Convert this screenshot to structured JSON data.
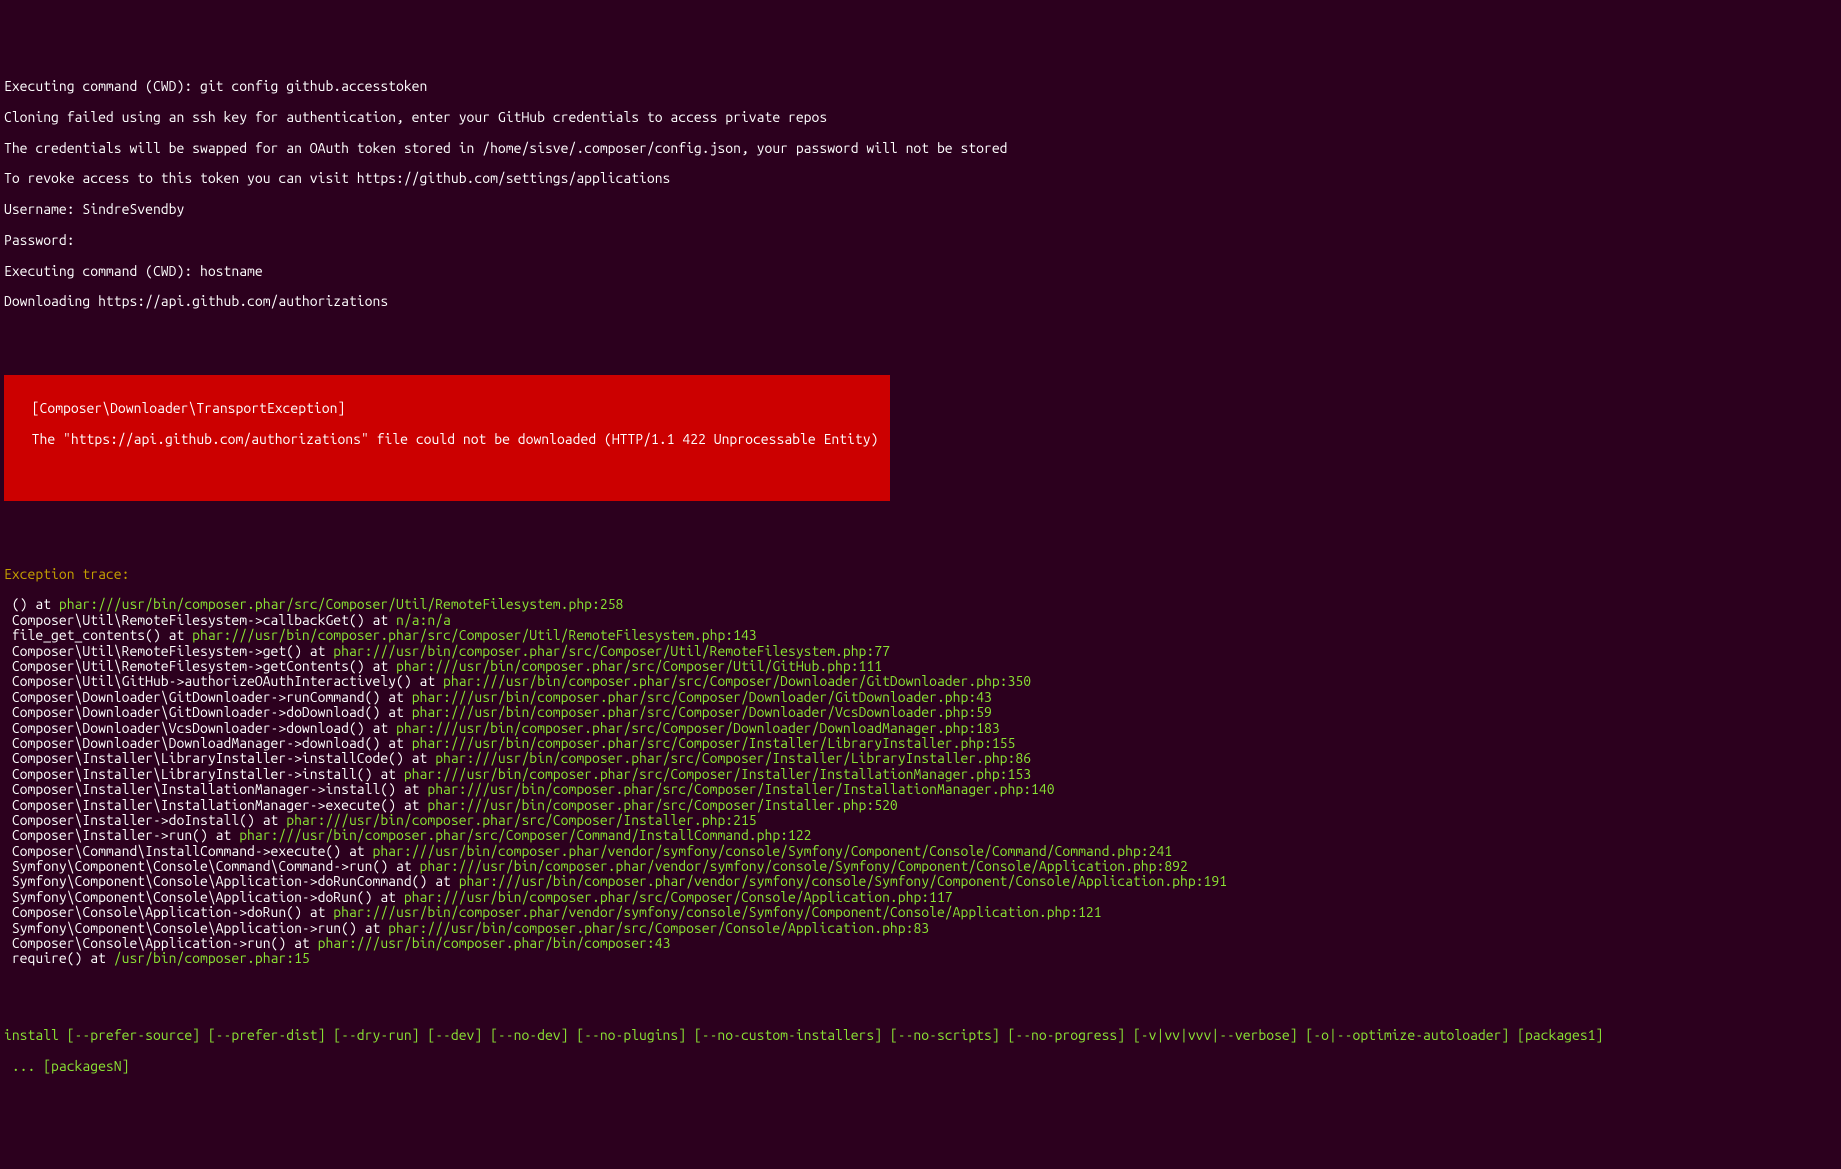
{
  "preamble": [
    "Executing command (CWD): git config github.accesstoken",
    "Cloning failed using an ssh key for authentication, enter your GitHub credentials to access private repos",
    "The credentials will be swapped for an OAuth token stored in /home/sisve/.composer/config.json, your password will not be stored",
    "To revoke access to this token you can visit https://github.com/settings/applications",
    "Username: SindreSvendby",
    "Password:",
    "Executing command (CWD): hostname",
    "Downloading https://api.github.com/authorizations"
  ],
  "error_box": {
    "line1": "  [Composer\\Downloader\\TransportException]",
    "line2": "  The \"https://api.github.com/authorizations\" file could not be downloaded (HTTP/1.1 422 Unprocessable Entity)"
  },
  "trace_header": "Exception trace:",
  "trace": [
    {
      "pre": " () at ",
      "path": "phar:///usr/bin/composer.phar/src/Composer/Util/RemoteFilesystem.php:258"
    },
    {
      "pre": " Composer\\Util\\RemoteFilesystem->callbackGet() at ",
      "path": "n/a:n/a"
    },
    {
      "pre": " file_get_contents() at ",
      "path": "phar:///usr/bin/composer.phar/src/Composer/Util/RemoteFilesystem.php:143"
    },
    {
      "pre": " Composer\\Util\\RemoteFilesystem->get() at ",
      "path": "phar:///usr/bin/composer.phar/src/Composer/Util/RemoteFilesystem.php:77"
    },
    {
      "pre": " Composer\\Util\\RemoteFilesystem->getContents() at ",
      "path": "phar:///usr/bin/composer.phar/src/Composer/Util/GitHub.php:111"
    },
    {
      "pre": " Composer\\Util\\GitHub->authorizeOAuthInteractively() at ",
      "path": "phar:///usr/bin/composer.phar/src/Composer/Downloader/GitDownloader.php:350"
    },
    {
      "pre": " Composer\\Downloader\\GitDownloader->runCommand() at ",
      "path": "phar:///usr/bin/composer.phar/src/Composer/Downloader/GitDownloader.php:43"
    },
    {
      "pre": " Composer\\Downloader\\GitDownloader->doDownload() at ",
      "path": "phar:///usr/bin/composer.phar/src/Composer/Downloader/VcsDownloader.php:59"
    },
    {
      "pre": " Composer\\Downloader\\VcsDownloader->download() at ",
      "path": "phar:///usr/bin/composer.phar/src/Composer/Downloader/DownloadManager.php:183"
    },
    {
      "pre": " Composer\\Downloader\\DownloadManager->download() at ",
      "path": "phar:///usr/bin/composer.phar/src/Composer/Installer/LibraryInstaller.php:155"
    },
    {
      "pre": " Composer\\Installer\\LibraryInstaller->installCode() at ",
      "path": "phar:///usr/bin/composer.phar/src/Composer/Installer/LibraryInstaller.php:86"
    },
    {
      "pre": " Composer\\Installer\\LibraryInstaller->install() at ",
      "path": "phar:///usr/bin/composer.phar/src/Composer/Installer/InstallationManager.php:153"
    },
    {
      "pre": " Composer\\Installer\\InstallationManager->install() at ",
      "path": "phar:///usr/bin/composer.phar/src/Composer/Installer/InstallationManager.php:140"
    },
    {
      "pre": " Composer\\Installer\\InstallationManager->execute() at ",
      "path": "phar:///usr/bin/composer.phar/src/Composer/Installer.php:520"
    },
    {
      "pre": " Composer\\Installer->doInstall() at ",
      "path": "phar:///usr/bin/composer.phar/src/Composer/Installer.php:215"
    },
    {
      "pre": " Composer\\Installer->run() at ",
      "path": "phar:///usr/bin/composer.phar/src/Composer/Command/InstallCommand.php:122"
    },
    {
      "pre": " Composer\\Command\\InstallCommand->execute() at ",
      "path": "phar:///usr/bin/composer.phar/vendor/symfony/console/Symfony/Component/Console/Command/Command.php:241"
    },
    {
      "pre": " Symfony\\Component\\Console\\Command\\Command->run() at ",
      "path": "phar:///usr/bin/composer.phar/vendor/symfony/console/Symfony/Component/Console/Application.php:892"
    },
    {
      "pre": " Symfony\\Component\\Console\\Application->doRunCommand() at ",
      "path": "phar:///usr/bin/composer.phar/vendor/symfony/console/Symfony/Component/Console/Application.php:191"
    },
    {
      "pre": " Symfony\\Component\\Console\\Application->doRun() at ",
      "path": "phar:///usr/bin/composer.phar/src/Composer/Console/Application.php:117"
    },
    {
      "pre": " Composer\\Console\\Application->doRun() at ",
      "path": "phar:///usr/bin/composer.phar/vendor/symfony/console/Symfony/Component/Console/Application.php:121"
    },
    {
      "pre": " Symfony\\Component\\Console\\Application->run() at ",
      "path": "phar:///usr/bin/composer.phar/src/Composer/Console/Application.php:83"
    },
    {
      "pre": " Composer\\Console\\Application->run() at ",
      "path": "phar:///usr/bin/composer.phar/bin/composer:43"
    },
    {
      "pre": " require() at ",
      "path": "/usr/bin/composer.phar:15"
    }
  ],
  "usage": {
    "line1": "install [--prefer-source] [--prefer-dist] [--dry-run] [--dev] [--no-dev] [--no-plugins] [--no-custom-installers] [--no-scripts] [--no-progress] [-v|vv|vvv|--verbose] [-o|--optimize-autoloader] [packages1]",
    "line2": " ... [packagesN]"
  }
}
